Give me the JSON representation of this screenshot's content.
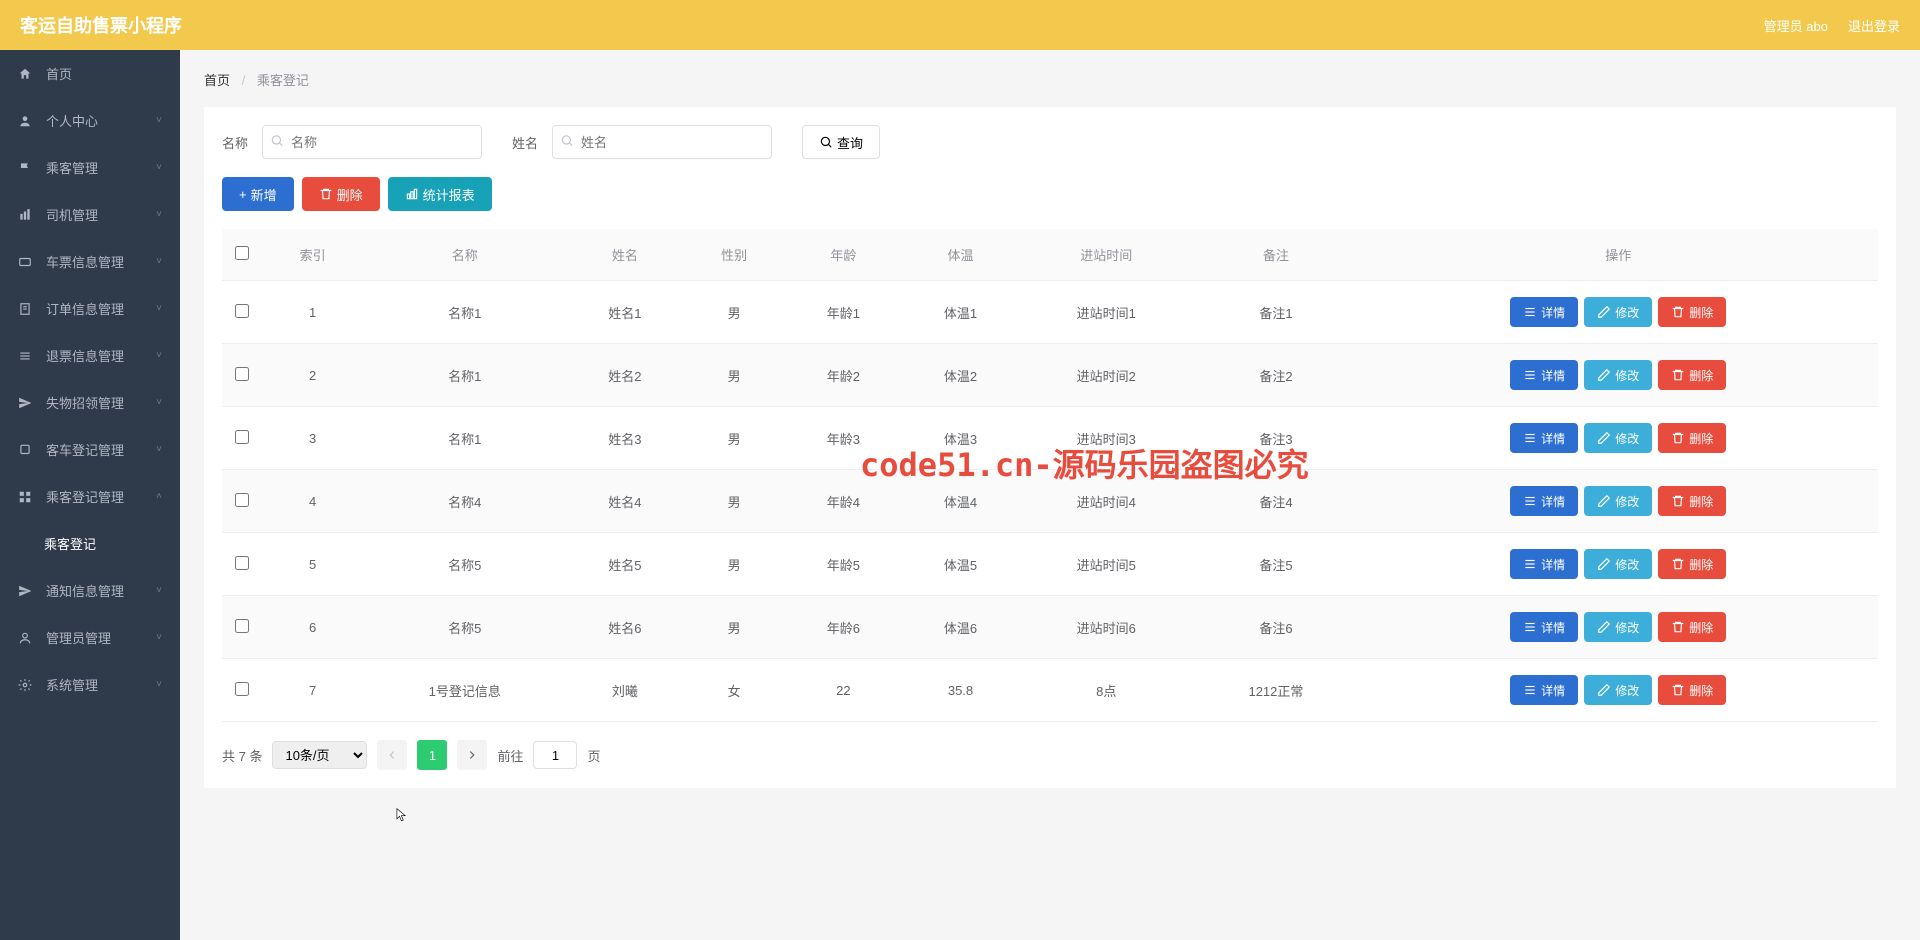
{
  "header": {
    "title": "客运自助售票小程序",
    "admin": "管理员 abo",
    "logout": "退出登录"
  },
  "sidebar": {
    "items": [
      {
        "icon": "home",
        "label": "首页"
      },
      {
        "icon": "user",
        "label": "个人中心",
        "arrow": true
      },
      {
        "icon": "flag",
        "label": "乘客管理",
        "arrow": true
      },
      {
        "icon": "bar",
        "label": "司机管理",
        "arrow": true
      },
      {
        "icon": "ticket",
        "label": "车票信息管理",
        "arrow": true
      },
      {
        "icon": "order",
        "label": "订单信息管理",
        "arrow": true
      },
      {
        "icon": "refund",
        "label": "退票信息管理",
        "arrow": true
      },
      {
        "icon": "lost",
        "label": "失物招领管理",
        "arrow": true
      },
      {
        "icon": "bus",
        "label": "客车登记管理",
        "arrow": true
      },
      {
        "icon": "grid",
        "label": "乘客登记管理",
        "arrow": true,
        "expanded": true
      },
      {
        "icon": "send",
        "label": "通知信息管理",
        "arrow": true
      },
      {
        "icon": "admin",
        "label": "管理员管理",
        "arrow": true
      },
      {
        "icon": "gear",
        "label": "系统管理",
        "arrow": true
      }
    ],
    "subItem": "乘客登记"
  },
  "breadcrumb": {
    "home": "首页",
    "current": "乘客登记"
  },
  "search": {
    "nameLabel": "名称",
    "namePlaceholder": "名称",
    "personLabel": "姓名",
    "personPlaceholder": "姓名",
    "queryBtn": "查询"
  },
  "actions": {
    "add": "新增",
    "delete": "删除",
    "stats": "统计报表"
  },
  "table": {
    "headers": [
      "",
      "索引",
      "名称",
      "姓名",
      "性别",
      "年龄",
      "体温",
      "进站时间",
      "备注",
      "操作"
    ],
    "rows": [
      {
        "idx": "1",
        "name": "名称1",
        "person": "姓名1",
        "gender": "男",
        "age": "年龄1",
        "temp": "体温1",
        "time": "进站时间1",
        "note": "备注1"
      },
      {
        "idx": "2",
        "name": "名称1",
        "person": "姓名2",
        "gender": "男",
        "age": "年龄2",
        "temp": "体温2",
        "time": "进站时间2",
        "note": "备注2"
      },
      {
        "idx": "3",
        "name": "名称1",
        "person": "姓名3",
        "gender": "男",
        "age": "年龄3",
        "temp": "体温3",
        "time": "进站时间3",
        "note": "备注3"
      },
      {
        "idx": "4",
        "name": "名称4",
        "person": "姓名4",
        "gender": "男",
        "age": "年龄4",
        "temp": "体温4",
        "time": "进站时间4",
        "note": "备注4"
      },
      {
        "idx": "5",
        "name": "名称5",
        "person": "姓名5",
        "gender": "男",
        "age": "年龄5",
        "temp": "体温5",
        "time": "进站时间5",
        "note": "备注5"
      },
      {
        "idx": "6",
        "name": "名称5",
        "person": "姓名6",
        "gender": "男",
        "age": "年龄6",
        "temp": "体温6",
        "time": "进站时间6",
        "note": "备注6"
      },
      {
        "idx": "7",
        "name": "1号登记信息",
        "person": "刘曦",
        "gender": "女",
        "age": "22",
        "temp": "35.8",
        "time": "8点",
        "note": "1212正常"
      }
    ],
    "rowBtns": {
      "detail": "详情",
      "edit": "修改",
      "delete": "删除"
    }
  },
  "pagination": {
    "total": "共 7 条",
    "pageSize": "10条/页",
    "current": "1",
    "gotoPrefix": "前往",
    "gotoValue": "1",
    "gotoSuffix": "页"
  },
  "watermark": "code51.cn",
  "watermarkRed": "code51.cn-源码乐园盗图必究"
}
